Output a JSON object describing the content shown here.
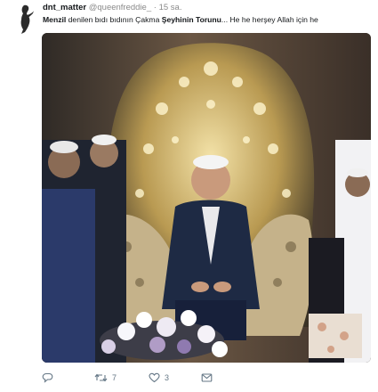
{
  "tweet": {
    "display_name": "dnt_matter",
    "handle": "@queenfreddie_",
    "separator": "·",
    "time": "15 sa.",
    "text_parts": [
      {
        "text": "Menzil",
        "bold": true
      },
      {
        "text": " denilen bıdı bıdının Çakma ",
        "bold": false
      },
      {
        "text": "Şeyhinin Torunu",
        "bold": true
      },
      {
        "text": "... He he herşey Allah  için he",
        "bold": false
      }
    ]
  },
  "actions": {
    "reply_count": "",
    "retweet_count": "7",
    "like_count": "3",
    "icons": [
      "reply-icon",
      "retweet-icon",
      "like-icon",
      "message-icon"
    ]
  },
  "colors": {
    "text": "#14171a",
    "secondary": "#657786",
    "background": "#ffffff"
  }
}
